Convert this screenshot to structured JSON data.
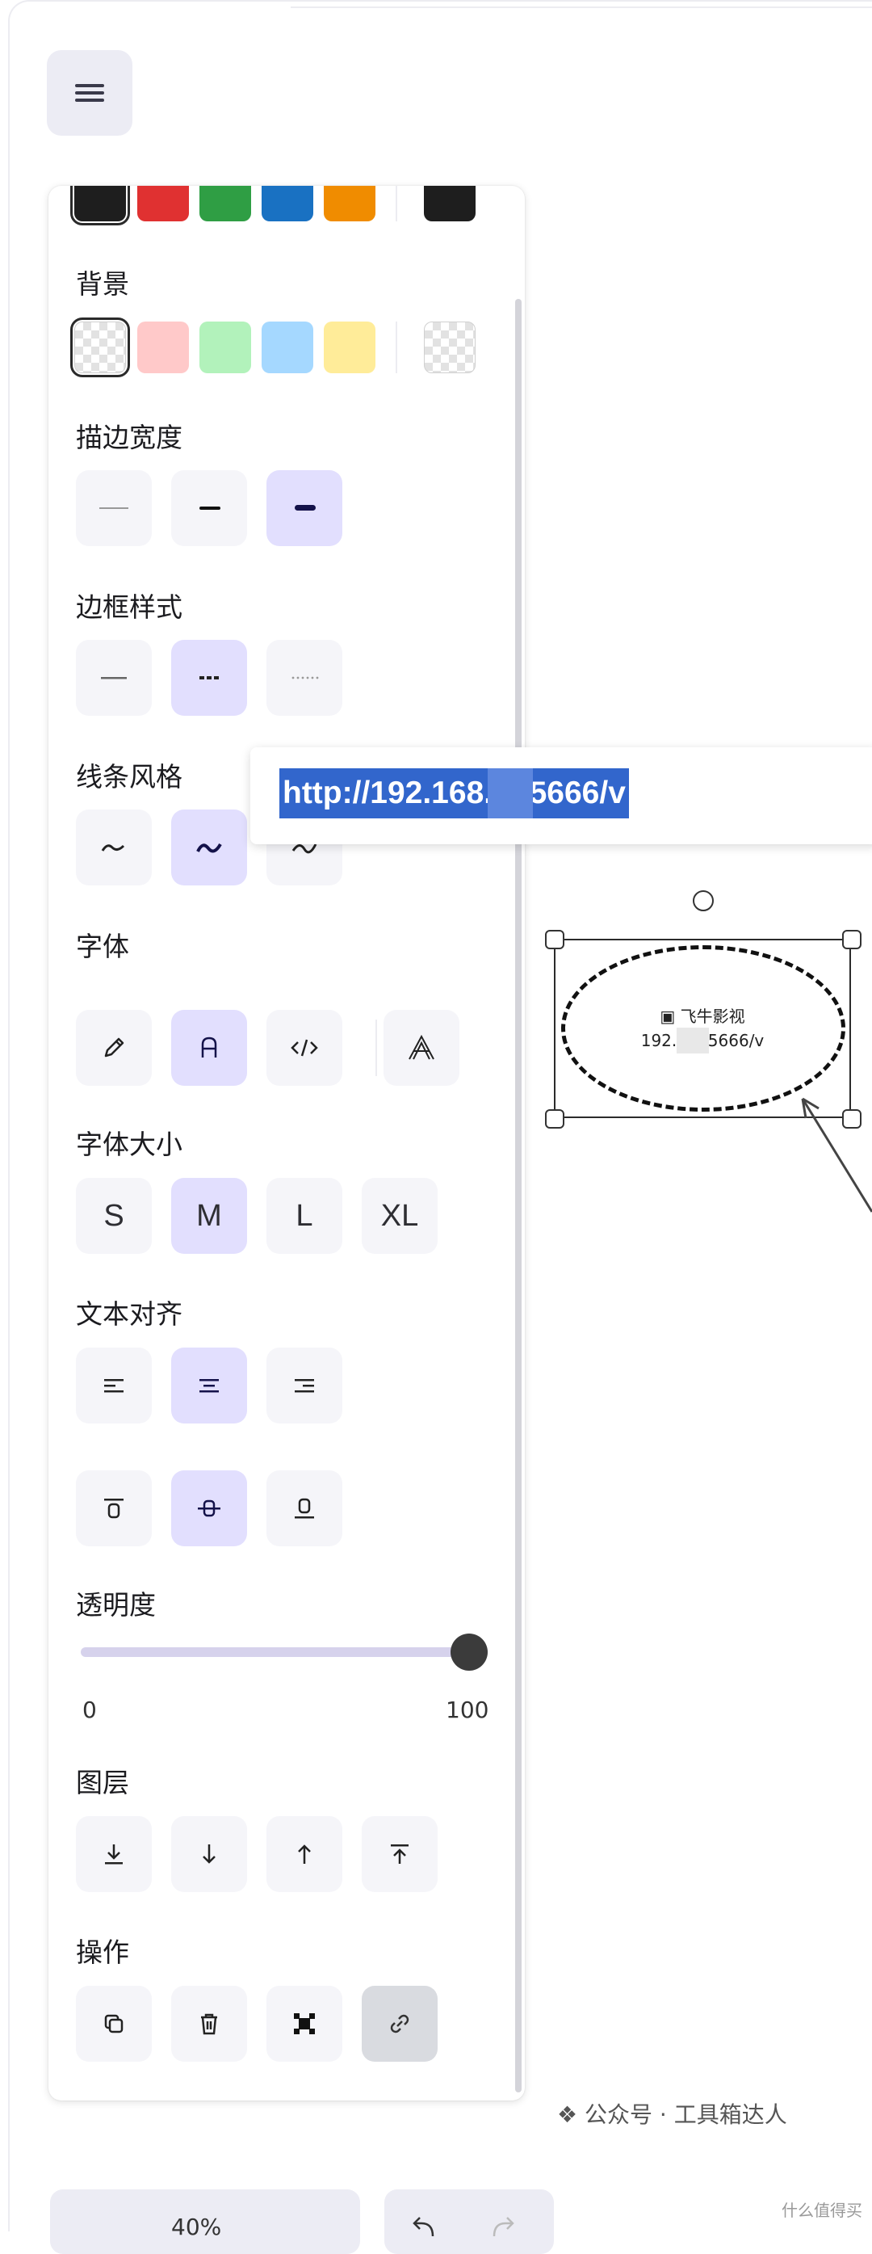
{
  "colors": {
    "stroke": [
      "#1e1e1e",
      "#e03131",
      "#2f9e44",
      "#1971c2",
      "#f08c00"
    ],
    "stroke_current": "#1e1e1e",
    "background_swatches": [
      "transparent",
      "#ffc9c9",
      "#b2f2bb",
      "#a5d8ff",
      "#ffec99"
    ],
    "background_current": "transparent",
    "accent": "#e2dffe",
    "selection": "#3266cc"
  },
  "sections": {
    "background": "背景",
    "stroke_width": "描边宽度",
    "stroke_style": "边框样式",
    "sloppiness": "线条风格",
    "font_family": "字体",
    "font_size": "字体大小",
    "text_align": "文本对齐",
    "opacity": "透明度",
    "layers": "图层",
    "actions": "操作"
  },
  "font_sizes": [
    "S",
    "M",
    "L",
    "XL"
  ],
  "opacity": {
    "min": "0",
    "max": "100",
    "value": 100
  },
  "link_popup": {
    "url": "http://192.168.   6:5666/v"
  },
  "shape": {
    "title": "飞牛影视",
    "url": "192.16      :5666/v"
  },
  "zoom": "40%",
  "watermark": "公众号 · 工具箱达人",
  "watermark_small": "什么值得买"
}
